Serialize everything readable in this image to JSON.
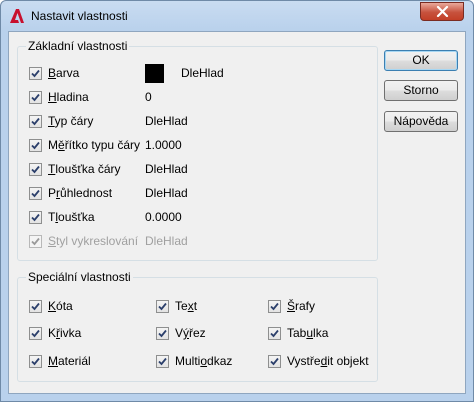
{
  "window": {
    "title": "Nastavit vlastnosti"
  },
  "basic": {
    "title": "Základní vlastnosti",
    "rows": [
      {
        "pre": "",
        "u": "B",
        "post": "arva",
        "value": "DleHlad",
        "checked": true,
        "disabled": false
      },
      {
        "pre": "",
        "u": "H",
        "post": "ladina",
        "value": "0",
        "checked": true,
        "disabled": false
      },
      {
        "pre": "",
        "u": "T",
        "post": "yp čáry",
        "value": "DleHlad",
        "checked": true,
        "disabled": false
      },
      {
        "pre": "M",
        "u": "ě",
        "post": "řítko typu čáry",
        "value": "1.0000",
        "checked": true,
        "disabled": false
      },
      {
        "pre": "",
        "u": "T",
        "post": "loušťka čáry",
        "value": "DleHlad",
        "checked": true,
        "disabled": false
      },
      {
        "pre": "P",
        "u": "r",
        "post": "ůhlednost",
        "value": "DleHlad",
        "checked": true,
        "disabled": false
      },
      {
        "pre": "T",
        "u": "l",
        "post": "oušťka",
        "value": "0.0000",
        "checked": true,
        "disabled": false
      },
      {
        "pre": "",
        "u": "S",
        "post": "tyl vykreslování",
        "value": "DleHlad",
        "checked": true,
        "disabled": true
      }
    ],
    "color_swatch": "#000000"
  },
  "special": {
    "title": "Speciální vlastnosti",
    "items": [
      {
        "pre": "",
        "u": "K",
        "post": "óta",
        "checked": true
      },
      {
        "pre": "Te",
        "u": "x",
        "post": "t",
        "checked": true
      },
      {
        "pre": "",
        "u": "Š",
        "post": "rafy",
        "checked": true
      },
      {
        "pre": "K",
        "u": "ř",
        "post": "ivka",
        "checked": true
      },
      {
        "pre": "V",
        "u": "ý",
        "post": "řez",
        "checked": true
      },
      {
        "pre": "Tab",
        "u": "u",
        "post": "lka",
        "checked": true
      },
      {
        "pre": "",
        "u": "M",
        "post": "ateriál",
        "checked": true
      },
      {
        "pre": "Multi",
        "u": "o",
        "post": "dkaz",
        "checked": true
      },
      {
        "pre": "Vystře",
        "u": "d",
        "post": "it objekt",
        "checked": true
      }
    ]
  },
  "buttons": {
    "ok": "OK",
    "cancel": "Storno",
    "help": "Nápověda"
  }
}
